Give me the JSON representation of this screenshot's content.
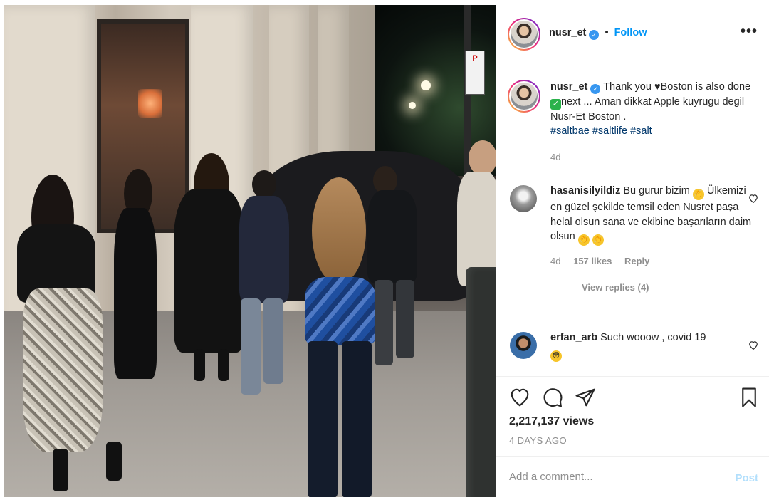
{
  "header": {
    "username": "nusr_et",
    "verified_icon": "verified-badge-icon",
    "separator": "•",
    "follow_label": "Follow",
    "more_icon": "more-options-icon",
    "more_glyph": "•••"
  },
  "caption": {
    "username": "nusr_et",
    "text_part1": "Thank you ",
    "text_part2": "Boston is also done ",
    "text_part3": "next ... Aman dikkat Apple kuyrugu degil Nusr-Et Boston .",
    "hashtags": [
      "#saltbae",
      "#saltlife",
      "#salt"
    ],
    "age": "4d"
  },
  "comments": [
    {
      "username": "hasanisilyildiz",
      "text_part1": "Bu gurur bizim ",
      "text_part2": "Ülkemizi en güzel şekilde temsil eden Nusret paşa helal olsun sana ve ekibine başarıların daim olsun ",
      "age": "4d",
      "likes": "157 likes",
      "reply_label": "Reply",
      "view_replies": "View replies (4)"
    },
    {
      "username": "erfan_arb",
      "text_part1": "Such wooow , covid 19",
      "age": ""
    }
  ],
  "actions": {
    "like_icon": "heart-icon",
    "comment_icon": "comment-icon",
    "share_icon": "share-icon",
    "save_icon": "bookmark-icon",
    "views": "2,217,137 views",
    "posted": "4 DAYS AGO"
  },
  "composer": {
    "placeholder": "Add a comment...",
    "post_label": "Post"
  },
  "colors": {
    "accent": "#0095f6",
    "verified": "#3897f0",
    "hashtag": "#00376b",
    "muted": "#8e8e8e",
    "post_disabled": "#b2dffc"
  }
}
